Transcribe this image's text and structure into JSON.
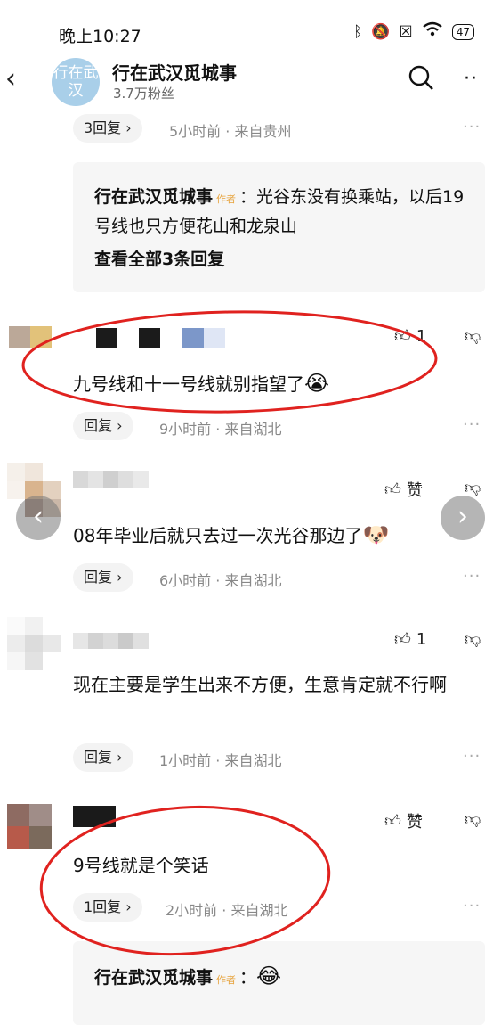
{
  "status": {
    "time": "晚上10:27",
    "battery": "47"
  },
  "header": {
    "avatar_text": "行在武汉",
    "account_name": "行在武汉觅城事",
    "fans": "3.7万粉丝"
  },
  "top_reply_row": {
    "reply_label": "3回复",
    "meta": "5小时前 · 来自贵州"
  },
  "author_reply_1": {
    "author": "行在武汉觅城事",
    "tag": "作者",
    "text": "：光谷东没有换乘站，以后19号线也只方便花山和龙泉山",
    "view_all": "查看全部3条回复"
  },
  "comments": [
    {
      "text": "九号线和十一号线就别指望了",
      "emoji": "😭",
      "like": "1",
      "reply_label": "回复",
      "meta": "9小时前 · 来自湖北"
    },
    {
      "text": "08年毕业后就只去过一次光谷那边了",
      "emoji": "🐶",
      "like": "赞",
      "reply_label": "回复",
      "meta": "6小时前 · 来自湖北"
    },
    {
      "text": "现在主要是学生出来不方便，生意肯定就不行啊",
      "emoji": "",
      "like": "1",
      "reply_label": "回复",
      "meta": "1小时前 · 来自湖北"
    },
    {
      "text": "9号线就是个笑话",
      "emoji": "",
      "like": "赞",
      "reply_label": "1回复",
      "meta": "2小时前 · 来自湖北"
    }
  ],
  "author_reply_2": {
    "author": "行在武汉觅城事",
    "tag": "作者",
    "text": "：",
    "emoji": "😂"
  },
  "icons": {
    "back": "chevron-left-icon",
    "search": "search-icon",
    "more": "more-icon",
    "like": "thumb-up-icon",
    "dislike": "thumb-down-icon"
  },
  "colors": {
    "annotation": "#e0221f",
    "author_tag": "#e7a33c"
  }
}
